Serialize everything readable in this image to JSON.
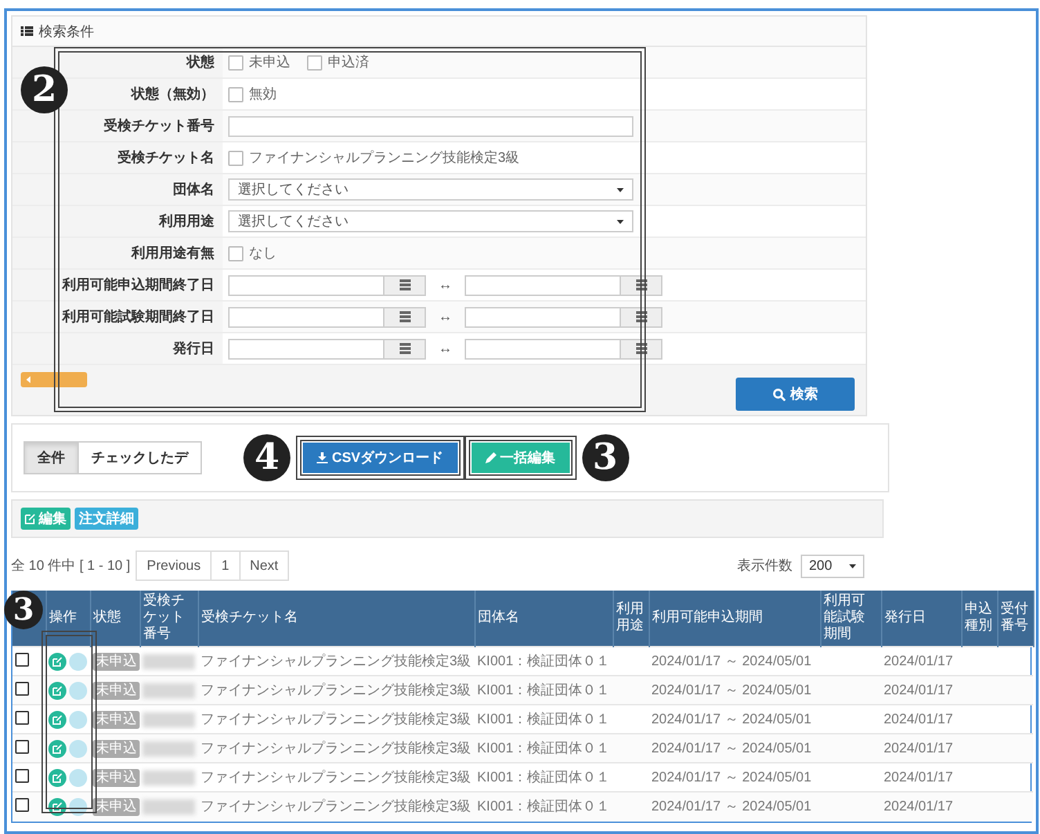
{
  "search_panel": {
    "title": "検索条件",
    "fields": [
      {
        "kind": "checks",
        "label": "状態",
        "options": [
          {
            "label": "未申込",
            "checked": false
          },
          {
            "label": "申込済",
            "checked": false
          }
        ]
      },
      {
        "kind": "checks",
        "label": "状態（無効）",
        "options": [
          {
            "label": "無効",
            "checked": false
          }
        ]
      },
      {
        "kind": "text",
        "label": "受検チケット番号"
      },
      {
        "kind": "checks",
        "label": "受検チケット名",
        "options": [
          {
            "label": "ファイナンシャルプランニング技能検定3級",
            "checked": false
          }
        ]
      },
      {
        "kind": "select",
        "label": "団体名",
        "value": "選択してください"
      },
      {
        "kind": "select",
        "label": "利用用途",
        "value": "選択してください"
      },
      {
        "kind": "checks",
        "label": "利用用途有無",
        "options": [
          {
            "label": "なし",
            "checked": false
          }
        ]
      },
      {
        "kind": "range",
        "label": "利用可能申込期間終了日",
        "separator": "↔"
      },
      {
        "kind": "range",
        "label": "利用可能試験期間終了日",
        "separator": "↔"
      },
      {
        "kind": "range",
        "label": "発行日",
        "separator": "↔"
      }
    ],
    "search_button": "検索"
  },
  "toolbar": {
    "scope_tabs": [
      {
        "label": "全件",
        "selected": true
      },
      {
        "label": "チェックしたデ",
        "selected": false
      }
    ],
    "csv_button": "CSVダウンロード",
    "bulk_edit_button": "一括編集"
  },
  "legend": [
    {
      "label": "編集",
      "color": "#26b99a"
    },
    {
      "label": "注文詳細",
      "color": "#3bafda"
    }
  ],
  "pager": {
    "summary": "全 10 件中 [ 1 - 10 ]",
    "previous": "Previous",
    "page": "1",
    "next": "Next",
    "page_size_label": "表示件数",
    "page_size": "200"
  },
  "table": {
    "columns": [
      {
        "label": "操作",
        "kind": "actions"
      },
      {
        "label": "状態",
        "kind": "status"
      },
      {
        "label": "受検チケット番号",
        "kind": "hidden"
      },
      {
        "label": "受検チケット名",
        "kind": "ticket_name"
      },
      {
        "label": "団体名",
        "kind": "group"
      },
      {
        "label": "利用用途",
        "kind": "usage"
      },
      {
        "label": "利用可能申込期間",
        "kind": "application_period"
      },
      {
        "label": "利用可能試験期間",
        "kind": "exam_period"
      },
      {
        "label": "発行日",
        "kind": "issue_date"
      },
      {
        "label": "申込種別",
        "kind": "application_type"
      },
      {
        "label": "受付番号",
        "kind": "receipt_number"
      }
    ],
    "rows": [
      {
        "checked": false,
        "status": "未申込",
        "ticket_name": "ファイナンシャルプランニング技能検定3級",
        "group": "KI001：検証団体０１",
        "application_period": "2024/01/17 ～ 2024/05/01",
        "issue_date": "2024/01/17"
      },
      {
        "checked": false,
        "status": "未申込",
        "ticket_name": "ファイナンシャルプランニング技能検定3級",
        "group": "KI001：検証団体０１",
        "application_period": "2024/01/17 ～ 2024/05/01",
        "issue_date": "2024/01/17"
      },
      {
        "checked": false,
        "status": "未申込",
        "ticket_name": "ファイナンシャルプランニング技能検定3級",
        "group": "KI001：検証団体０１",
        "application_period": "2024/01/17 ～ 2024/05/01",
        "issue_date": "2024/01/17"
      },
      {
        "checked": false,
        "status": "未申込",
        "ticket_name": "ファイナンシャルプランニング技能検定3級",
        "group": "KI001：検証団体０１",
        "application_period": "2024/01/17 ～ 2024/05/01",
        "issue_date": "2024/01/17"
      },
      {
        "checked": false,
        "status": "未申込",
        "ticket_name": "ファイナンシャルプランニング技能検定3級",
        "group": "KI001：検証団体０１",
        "application_period": "2024/01/17 ～ 2024/05/01",
        "issue_date": "2024/01/17"
      },
      {
        "checked": false,
        "status": "未申込",
        "ticket_name": "ファイナンシャルプランニング技能検定3級",
        "group": "KI001：検証団体０１",
        "application_period": "2024/01/17 ～ 2024/05/01",
        "issue_date": "2024/01/17"
      }
    ]
  },
  "annotations": [
    {
      "number": "2"
    },
    {
      "number": "4"
    },
    {
      "number": "3"
    },
    {
      "number": "3"
    }
  ]
}
